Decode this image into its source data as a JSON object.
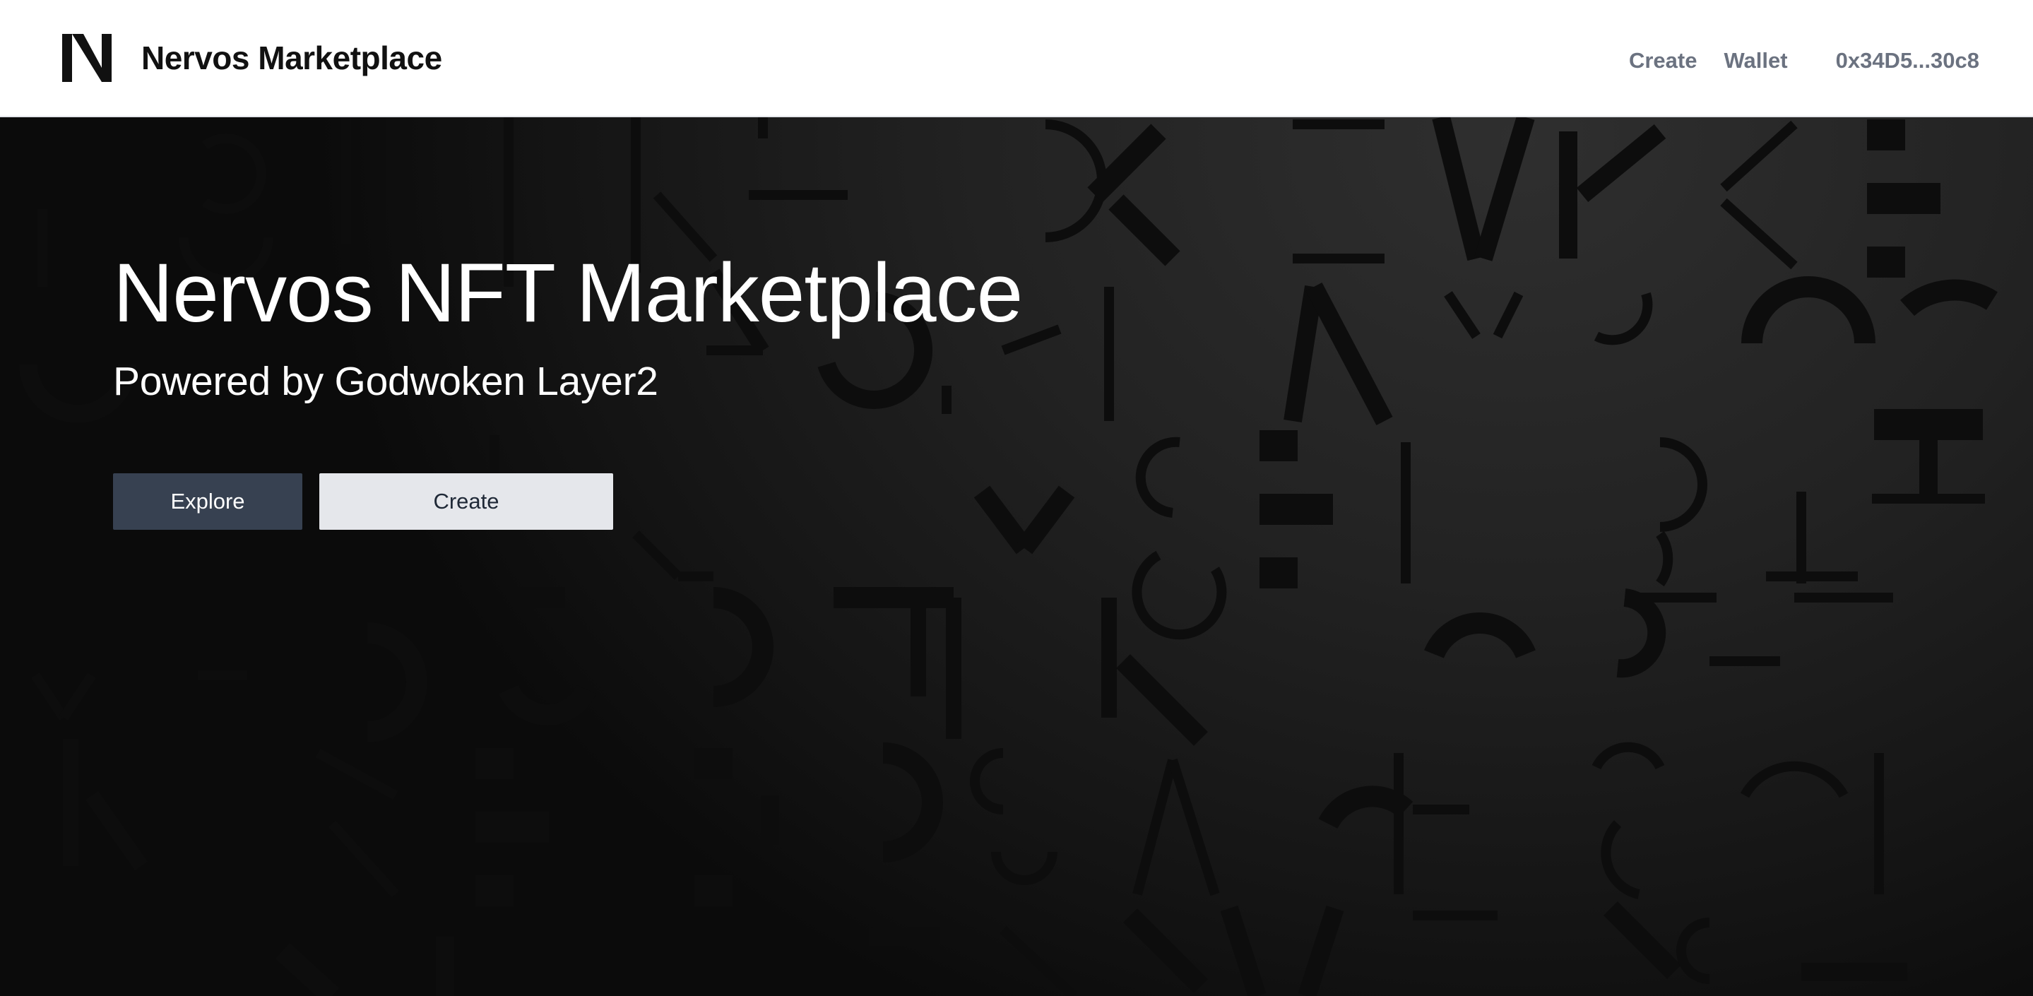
{
  "header": {
    "brand_name": "Nervos Marketplace",
    "logo_icon": "nervos-n-logo",
    "nav": {
      "create_label": "Create",
      "wallet_label": "Wallet",
      "address_label": "0x34D5...30c8"
    }
  },
  "hero": {
    "title": "Nervos NFT Marketplace",
    "subtitle": "Powered by Godwoken Layer2",
    "explore_label": "Explore",
    "create_label": "Create"
  },
  "colors": {
    "header_bg": "#ffffff",
    "brand_text": "#111111",
    "nav_text": "#6b7280",
    "hero_bg": "#1c1c1c",
    "explore_bg": "#374151",
    "create_bg": "#e5e7eb"
  }
}
